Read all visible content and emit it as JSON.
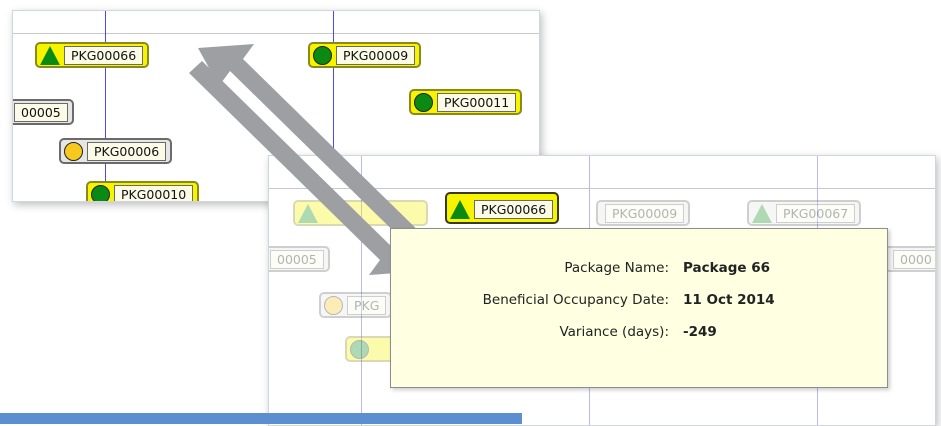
{
  "back_view": {
    "badges": [
      {
        "code": "PKG00066",
        "indicator": "green-triangle-icon"
      },
      {
        "code": "PKG00009",
        "indicator": "green-circle-icon"
      },
      {
        "code": "00005",
        "indicator": "none"
      },
      {
        "code": "PKG00011",
        "indicator": "green-circle-icon"
      },
      {
        "code": "PKG00006",
        "indicator": "amber-circle-icon"
      },
      {
        "code": "PKG00010",
        "indicator": "green-circle-icon"
      }
    ]
  },
  "front_view": {
    "badges": [
      {
        "code": "PKG00066",
        "indicator": "green-triangle-icon",
        "state": "highlighted"
      },
      {
        "code": "PKG00009",
        "indicator": "none",
        "state": "faded"
      },
      {
        "code": "PKG00067",
        "indicator": "green-triangle-icon",
        "state": "faded"
      },
      {
        "code": "00005",
        "indicator": "none",
        "state": "faded"
      },
      {
        "code": "0000",
        "indicator": "none",
        "state": "faded"
      },
      {
        "code": "PKG",
        "indicator": "amber-circle-icon",
        "state": "faded"
      }
    ],
    "tooltip": {
      "rows": [
        {
          "label": "Package Name:",
          "value": "Package 66"
        },
        {
          "label": "Beneficial Occupancy Date:",
          "value": "11 Oct 2014"
        },
        {
          "label": "Variance (days):",
          "value": "-249"
        }
      ]
    }
  },
  "colors": {
    "badge_yellow": "#f7f400",
    "badge_grey": "#e6e6e6",
    "indicator_green": "#0a8a12",
    "indicator_amber": "#f7c81e",
    "tooltip_bg": "#ffffe1",
    "arrow_grey": "#9d9fa2",
    "accent_blue": "#5b8fd0"
  }
}
